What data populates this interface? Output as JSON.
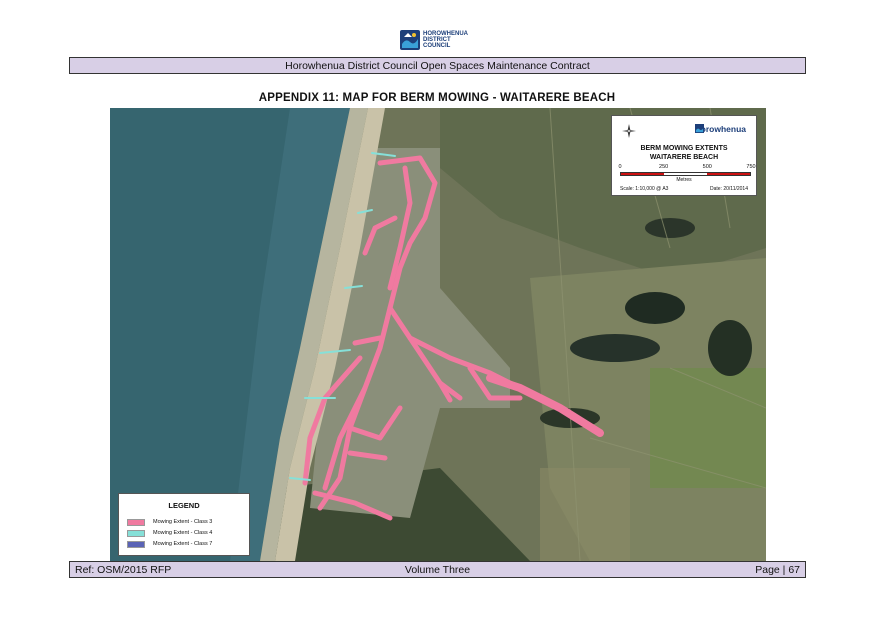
{
  "logo": {
    "line1": "HOROWHENUA",
    "line2": "DISTRICT",
    "line3": "COUNCIL",
    "brand_color": "#1d3f7a"
  },
  "header": {
    "contract_title": "Horowhenua District Council Open Spaces Maintenance Contract"
  },
  "page_title": "APPENDIX 11:  MAP FOR BERM MOWING - WAITARERE BEACH",
  "map": {
    "legend": {
      "title": "LEGEND",
      "items": [
        {
          "label": "Mowing Extent - Class 3",
          "color": "#f07aa0"
        },
        {
          "label": "Mowing Extent - Class 4",
          "color": "#86e0d8"
        },
        {
          "label": "Mowing Extent - Class 7",
          "color": "#5a63b5"
        }
      ]
    },
    "info": {
      "brand": "Horowhenua",
      "title_line1": "BERM MOWING EXTENTS",
      "title_line2": "WAITARERE BEACH",
      "scale_ticks": [
        "0",
        "250",
        "500",
        "750"
      ],
      "scale_units": "Metres",
      "scale_text": "Scale: 1:10,000 @ A3",
      "date_text": "Date: 20/11/2014",
      "scale_colors": [
        "#cc1111",
        "#ffffff",
        "#cc1111"
      ]
    }
  },
  "footer": {
    "ref": "Ref: OSM/2015 RFP",
    "volume": "Volume Three",
    "page": "Page | 67"
  }
}
